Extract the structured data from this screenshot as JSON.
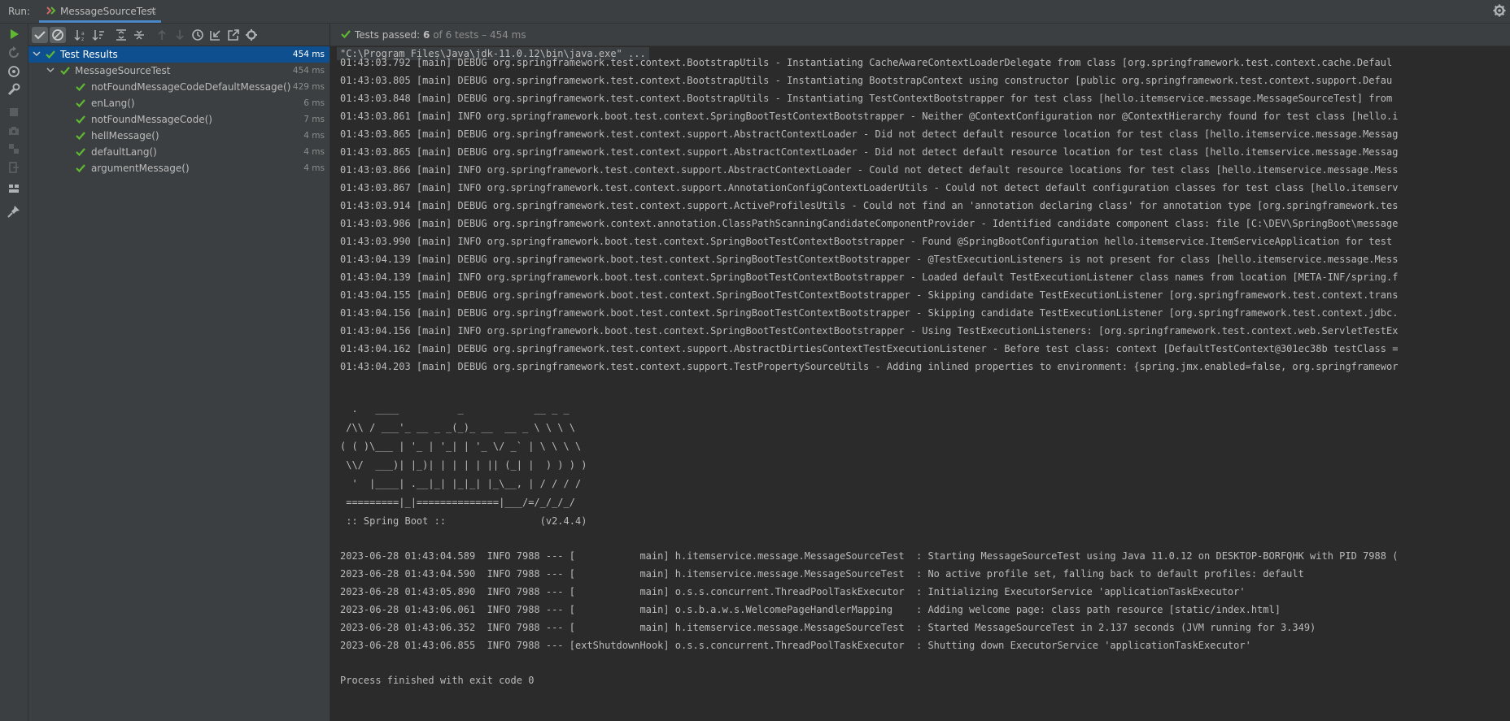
{
  "header": {
    "run_label": "Run:",
    "tab_title": "MessageSourceTest",
    "tab_close": "×"
  },
  "status": {
    "prefix": "Tests passed: ",
    "passed": "6",
    "rest": " of 6 tests – 454 ms"
  },
  "tree": {
    "root": {
      "label": "Test Results",
      "time": "454 ms"
    },
    "suite": {
      "label": "MessageSourceTest",
      "time": "454 ms"
    },
    "tests": [
      {
        "label": "notFoundMessageCodeDefaultMessage()",
        "time": "429 ms"
      },
      {
        "label": "enLang()",
        "time": "6 ms"
      },
      {
        "label": "notFoundMessageCode()",
        "time": "7 ms"
      },
      {
        "label": "hellMessage()",
        "time": "4 ms"
      },
      {
        "label": "defaultLang()",
        "time": "4 ms"
      },
      {
        "label": "argumentMessage()",
        "time": "4 ms"
      }
    ]
  },
  "console": {
    "command": "\"C:\\Program Files\\Java\\jdk-11.0.12\\bin\\java.exe\" ...",
    "debug_lines": [
      "01:43:03.792 [main] DEBUG org.springframework.test.context.BootstrapUtils - Instantiating CacheAwareContextLoaderDelegate from class [org.springframework.test.context.cache.Defaul",
      "01:43:03.805 [main] DEBUG org.springframework.test.context.BootstrapUtils - Instantiating BootstrapContext using constructor [public org.springframework.test.context.support.Defau",
      "01:43:03.848 [main] DEBUG org.springframework.test.context.BootstrapUtils - Instantiating TestContextBootstrapper for test class [hello.itemservice.message.MessageSourceTest] from",
      "01:43:03.861 [main] INFO org.springframework.boot.test.context.SpringBootTestContextBootstrapper - Neither @ContextConfiguration nor @ContextHierarchy found for test class [hello.i",
      "01:43:03.865 [main] DEBUG org.springframework.test.context.support.AbstractContextLoader - Did not detect default resource location for test class [hello.itemservice.message.Messag",
      "01:43:03.865 [main] DEBUG org.springframework.test.context.support.AbstractContextLoader - Did not detect default resource location for test class [hello.itemservice.message.Messag",
      "01:43:03.866 [main] INFO org.springframework.test.context.support.AbstractContextLoader - Could not detect default resource locations for test class [hello.itemservice.message.Mess",
      "01:43:03.867 [main] INFO org.springframework.test.context.support.AnnotationConfigContextLoaderUtils - Could not detect default configuration classes for test class [hello.itemserv",
      "01:43:03.914 [main] DEBUG org.springframework.test.context.support.ActiveProfilesUtils - Could not find an 'annotation declaring class' for annotation type [org.springframework.tes",
      "01:43:03.986 [main] DEBUG org.springframework.context.annotation.ClassPathScanningCandidateComponentProvider - Identified candidate component class: file [C:\\DEV\\SpringBoot\\message",
      "01:43:03.990 [main] INFO org.springframework.boot.test.context.SpringBootTestContextBootstrapper - Found @SpringBootConfiguration hello.itemservice.ItemServiceApplication for test",
      "01:43:04.139 [main] DEBUG org.springframework.boot.test.context.SpringBootTestContextBootstrapper - @TestExecutionListeners is not present for class [hello.itemservice.message.Mess",
      "01:43:04.139 [main] INFO org.springframework.boot.test.context.SpringBootTestContextBootstrapper - Loaded default TestExecutionListener class names from location [META-INF/spring.f",
      "01:43:04.155 [main] DEBUG org.springframework.boot.test.context.SpringBootTestContextBootstrapper - Skipping candidate TestExecutionListener [org.springframework.test.context.trans",
      "01:43:04.156 [main] DEBUG org.springframework.boot.test.context.SpringBootTestContextBootstrapper - Skipping candidate TestExecutionListener [org.springframework.test.context.jdbc.",
      "01:43:04.156 [main] INFO org.springframework.boot.test.context.SpringBootTestContextBootstrapper - Using TestExecutionListeners: [org.springframework.test.context.web.ServletTestEx",
      "01:43:04.162 [main] DEBUG org.springframework.test.context.support.AbstractDirtiesContextTestExecutionListener - Before test class: context [DefaultTestContext@301ec38b testClass =",
      "01:43:04.203 [main] DEBUG org.springframework.test.context.support.TestPropertySourceUtils - Adding inlined properties to environment: {spring.jmx.enabled=false, org.springframewor"
    ],
    "banner": [
      "  .   ____          _            __ _ _",
      " /\\\\ / ___'_ __ _ _(_)_ __  __ _ \\ \\ \\ \\",
      "( ( )\\___ | '_ | '_| | '_ \\/ _` | \\ \\ \\ \\",
      " \\\\/  ___)| |_)| | | | | || (_| |  ) ) ) )",
      "  '  |____| .__|_| |_|_| |_\\__, | / / / /",
      " =========|_|==============|___/=/_/_/_/",
      " :: Spring Boot ::                (v2.4.4)"
    ],
    "app_lines": [
      "2023-06-28 01:43:04.589  INFO 7988 --- [           main] h.itemservice.message.MessageSourceTest  : Starting MessageSourceTest using Java 11.0.12 on DESKTOP-BORFQHK with PID 7988 (",
      "2023-06-28 01:43:04.590  INFO 7988 --- [           main] h.itemservice.message.MessageSourceTest  : No active profile set, falling back to default profiles: default",
      "2023-06-28 01:43:05.890  INFO 7988 --- [           main] o.s.s.concurrent.ThreadPoolTaskExecutor  : Initializing ExecutorService 'applicationTaskExecutor'",
      "2023-06-28 01:43:06.061  INFO 7988 --- [           main] o.s.b.a.w.s.WelcomePageHandlerMapping    : Adding welcome page: class path resource [static/index.html]",
      "2023-06-28 01:43:06.352  INFO 7988 --- [           main] h.itemservice.message.MessageSourceTest  : Started MessageSourceTest in 2.137 seconds (JVM running for 3.349)",
      "2023-06-28 01:43:06.855  INFO 7988 --- [extShutdownHook] o.s.s.concurrent.ThreadPoolTaskExecutor  : Shutting down ExecutorService 'applicationTaskExecutor'"
    ],
    "exit_line": "Process finished with exit code 0"
  },
  "colors": {
    "pass_green": "#5fb832",
    "selection": "#0d4f8f",
    "accent_tab": "#4a88c7",
    "panel": "#3c3f41",
    "console_bg": "#2b2b2b"
  },
  "icons": {
    "left_toolbar": [
      "run-icon",
      "rerun-failed-icon",
      "debug-icon",
      "wrench-icon",
      "stop-icon",
      "camera-icon",
      "layout-icon",
      "exit-icon",
      "grid-icon",
      "pin-icon"
    ],
    "test_toolbar": [
      "show-passed-icon",
      "show-ignored-icon",
      "sort-alpha-icon",
      "sort-duration-icon",
      "expand-all-icon",
      "collapse-all-icon",
      "prev-failed-icon",
      "next-failed-icon",
      "history-icon",
      "import-icon",
      "export-icon",
      "settings-icon"
    ]
  }
}
